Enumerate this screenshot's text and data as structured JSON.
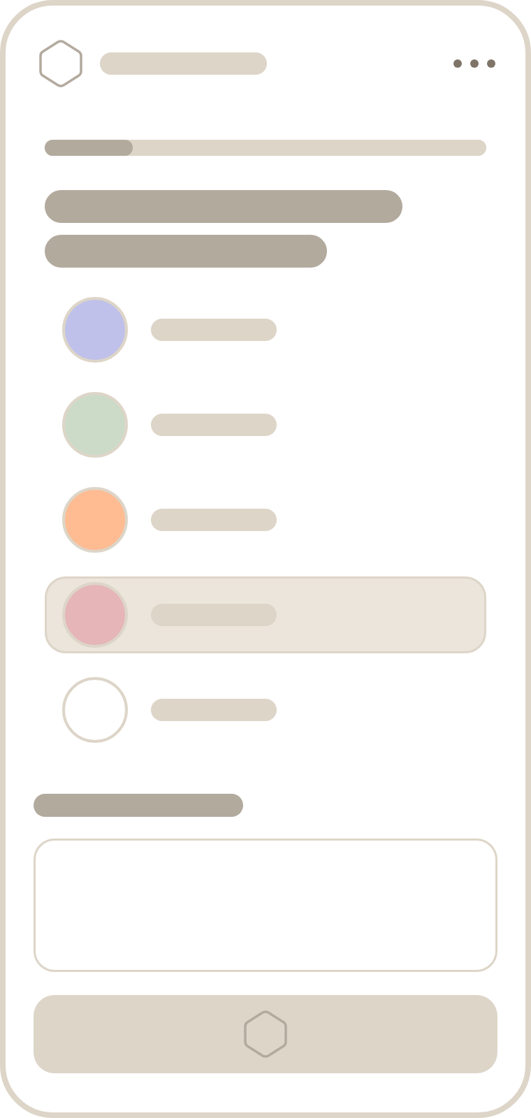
{
  "progress": {
    "level": 0.2
  },
  "options": [
    {
      "color": "#bfc1ea",
      "selected": false
    },
    {
      "color": "#cbdbc8",
      "selected": false
    },
    {
      "color": "#ffbb92",
      "selected": false
    },
    {
      "color": "#e6b5b8",
      "selected": true
    },
    {
      "color": "#ffffff",
      "selected": false
    }
  ]
}
